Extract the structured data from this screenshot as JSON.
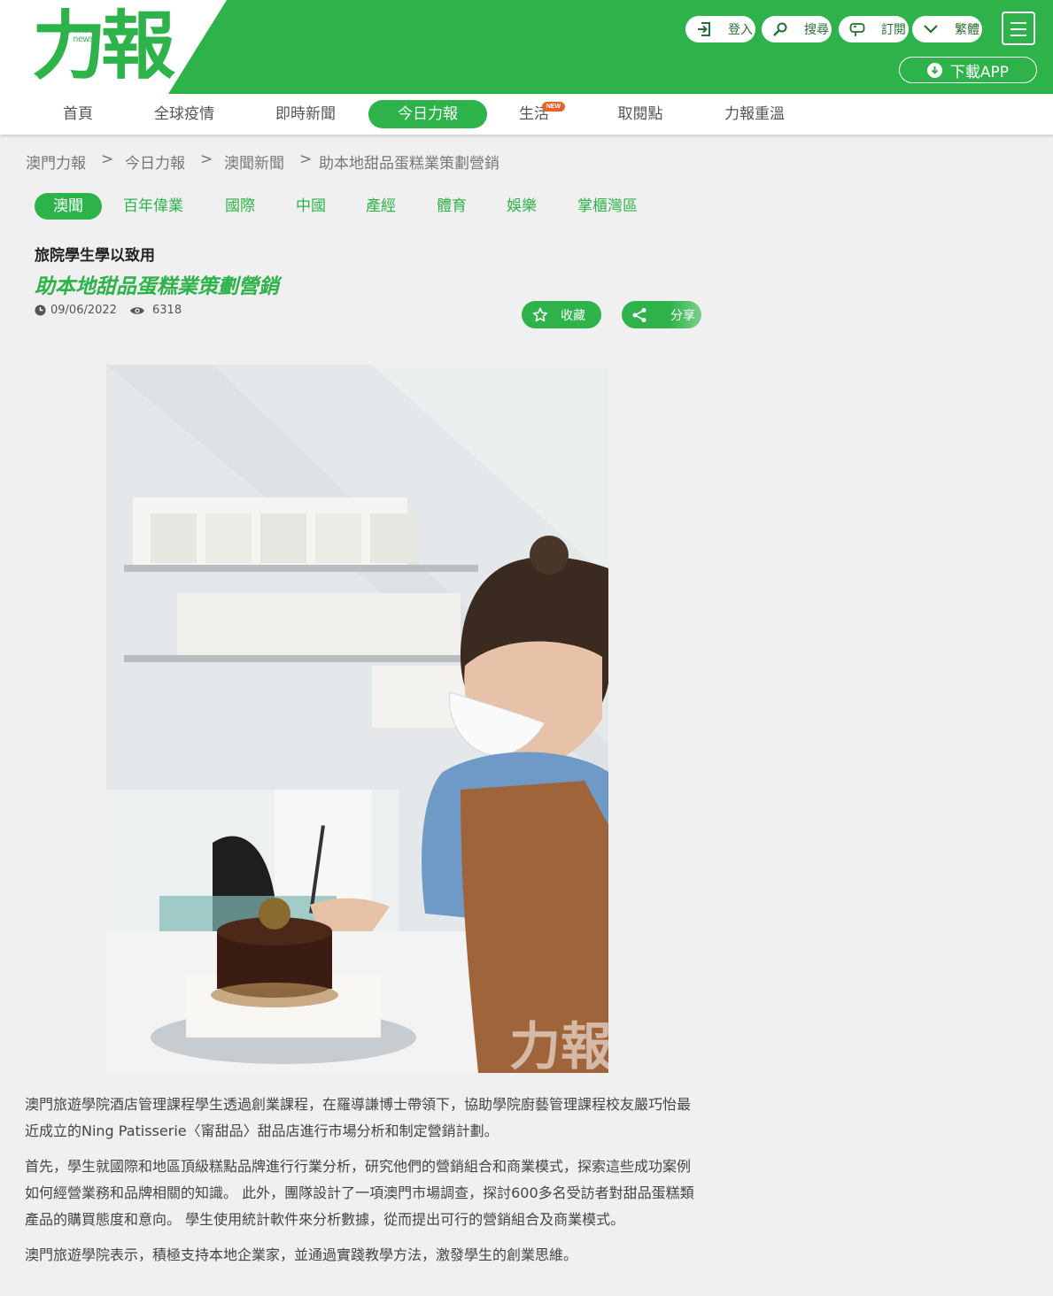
{
  "brand": {
    "logo": "力報",
    "logo_sub_1": "exmoo",
    "logo_sub_2": "news"
  },
  "header": {
    "buttons": [
      {
        "label": "登入",
        "icon": "login-icon"
      },
      {
        "label": "搜尋",
        "icon": "search-icon"
      },
      {
        "label": "訂閱",
        "icon": "subscribe-icon"
      },
      {
        "label": "繁體",
        "icon": "chevron-down-icon"
      }
    ],
    "app_label": "下載APP",
    "colors": {
      "brand": "#2db34a",
      "badge": "#e8632b"
    }
  },
  "nav": {
    "items": [
      "首頁",
      "全球疫情",
      "即時新聞",
      "今日力報",
      "生活",
      "取閱點",
      "力報重溫"
    ],
    "active": "今日力報",
    "badge": "NEW"
  },
  "breadcrumb": [
    "澳門力報",
    "今日力報",
    "澳聞新聞",
    "助本地甜品蛋糕業策劃營銷"
  ],
  "breadcrumb_sep": ">",
  "categories": [
    "澳聞",
    "百年偉業",
    "國際",
    "中國",
    "產經",
    "體育",
    "娛樂",
    "掌櫃灣區"
  ],
  "article": {
    "pre_title": "旅院學生學以致用",
    "title": "助本地甜品蛋糕業策劃營銷",
    "date": "09/06/2022",
    "views": "6318",
    "bookmark_label": "收藏",
    "share_label": "分享",
    "paragraphs": [
      "澳門旅遊學院酒店管理課程學生透過創業課程，在羅導謙博士帶領下，協助學院廚藝管理課程校友嚴巧怡最近成立的Ning Patisserie〈甯甜品〉甜品店進行市場分析和制定營銷計劃。",
      "首先，學生就國際和地區頂級糕點品牌進行行業分析，研究他們的營銷組合和商業模式，探索這些成功案例如何經營業務和品牌相關的知識。 此外，團隊設計了一項澳門市場調查，探討600多名受訪者對甜品蛋糕類產品的購買態度和意向。 學生使用統計軟件來分析數據，從而提出可行的營銷組合及商業模式。",
      "澳門旅遊學院表示，積極支持本地企業家，並通過實踐教學方法，激發學生的創業思維。"
    ]
  }
}
